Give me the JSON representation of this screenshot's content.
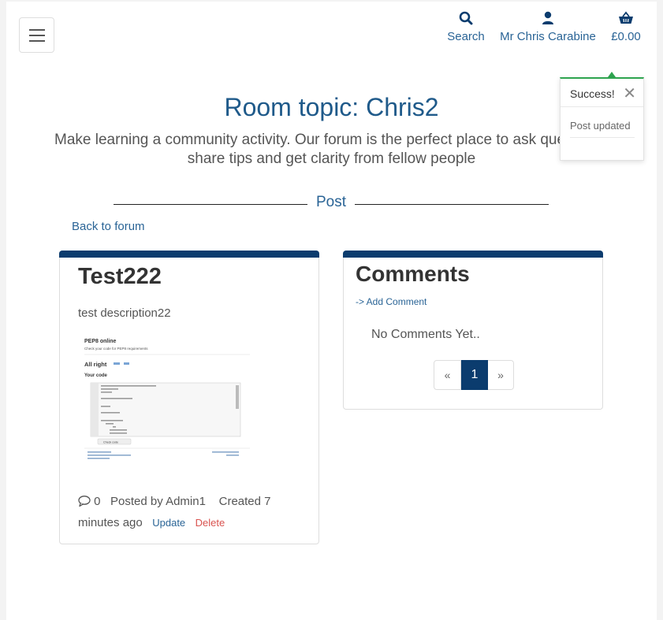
{
  "header": {
    "search_label": "Search",
    "user_label": "Mr Chris Carabine",
    "basket_label": "£0.00"
  },
  "hero": {
    "title": "Room topic: Chris2",
    "subtitle": "Make learning a community activity. Our forum is the perfect place to ask questions, share tips and get clarity from fellow people"
  },
  "section": {
    "divider_label": "Post",
    "back_link": "Back to forum"
  },
  "post": {
    "title": "Test222",
    "description": "test description22",
    "comment_count": "0",
    "posted_by": "Posted by Admin1",
    "created": "Created 7 minutes ago",
    "update_label": "Update",
    "delete_label": "Delete",
    "thumbnail": {
      "heading": "PEP8 online",
      "subheading": "Check your code for PEP8 requirements",
      "result": "All right",
      "code_label": "Your code",
      "button": "Check code"
    }
  },
  "comments": {
    "title": "Comments",
    "add_link": "-> Add Comment",
    "empty_text": "No Comments Yet..",
    "pagination": {
      "prev": "«",
      "current": "1",
      "next": "»"
    }
  },
  "toast": {
    "title": "Success!",
    "message": "Post updated",
    "close": "✕"
  },
  "colors": {
    "accent": "#0b3c6e",
    "link": "#2a6496",
    "success": "#2ea44f",
    "danger": "#d9534f"
  },
  "icons": [
    "hamburger-icon",
    "search-icon",
    "user-icon",
    "basket-icon",
    "comment-icon",
    "close-icon"
  ]
}
